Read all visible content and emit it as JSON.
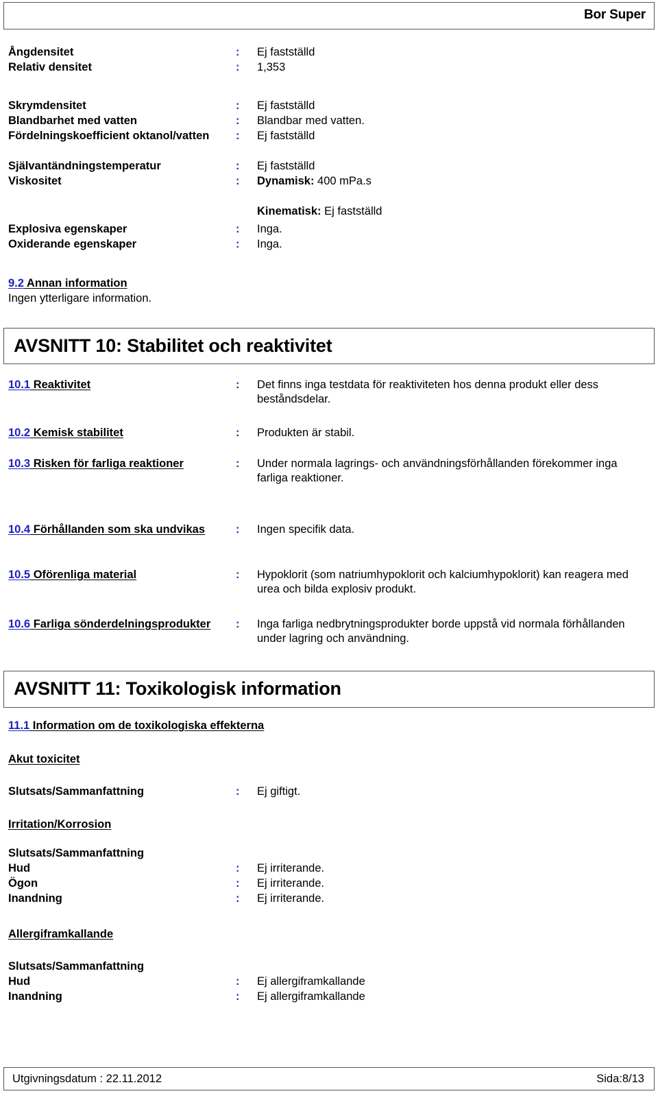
{
  "header": {
    "product_title": "Bor Super"
  },
  "properties_table": {
    "rows": [
      {
        "label": "Ångdensitet",
        "colon": ":",
        "value": "Ej fastställd"
      },
      {
        "label": "Relativ densitet",
        "colon": ":",
        "value": "1,353"
      },
      {
        "label": "Skrymdensitet",
        "colon": ":",
        "value": "Ej fastställd"
      },
      {
        "label": "Blandbarhet med vatten",
        "colon": ":",
        "value": "Blandbar med vatten."
      },
      {
        "label": "Fördelningskoefficient oktanol/vatten",
        "colon": ":",
        "value": "Ej fastställd"
      },
      {
        "label": "Självantändningstemperatur",
        "colon": ":",
        "value": "Ej fastställd"
      },
      {
        "label": "Viskositet",
        "colon": ":",
        "value_bold": "Dynamisk:",
        "value_rest": " 400 mPa.s"
      },
      {
        "label": "",
        "colon": "",
        "value_bold": "Kinematisk:",
        "value_rest": " Ej fastställd"
      },
      {
        "label": "Explosiva egenskaper",
        "colon": ":",
        "value": "Inga."
      },
      {
        "label": "Oxiderande egenskaper",
        "colon": ":",
        "value": "Inga."
      }
    ]
  },
  "section_9_2": {
    "number": "9.2",
    "title": " Annan information",
    "body": "Ingen ytterligare information."
  },
  "section_10": {
    "heading": "AVSNITT 10: Stabilitet och reaktivitet",
    "items": [
      {
        "number": "10.1",
        "title": " Reaktivitet",
        "colon": ":",
        "value": "Det finns inga testdata för reaktiviteten hos denna produkt eller dess beståndsdelar."
      },
      {
        "number": "10.2",
        "title": " Kemisk stabilitet",
        "colon": ":",
        "value": "Produkten är stabil."
      },
      {
        "number": "10.3",
        "title": " Risken för farliga reaktioner",
        "colon": ":",
        "value": "Under normala lagrings- och användningsförhållanden förekommer inga farliga reaktioner."
      },
      {
        "number": "10.4",
        "title": " Förhållanden som ska undvikas",
        "colon": ":",
        "value": "Ingen specifik data."
      },
      {
        "number": "10.5",
        "title": " Oförenliga material",
        "colon": ":",
        "value": "Hypoklorit (som natriumhypoklorit och kalciumhypoklorit) kan reagera med urea och bilda explosiv produkt."
      },
      {
        "number": "10.6",
        "title": " Farliga sönderdelningsprodukter",
        "colon": ":",
        "value": "Inga farliga nedbrytningsprodukter borde uppstå vid normala förhållanden under lagring och användning."
      }
    ]
  },
  "section_11": {
    "heading": "AVSNITT 11: Toxikologisk information",
    "sub_number": "11.1",
    "sub_title": " Information om de toxikologiska effekterna",
    "groups": [
      {
        "heading": "Akut toxicitet",
        "summary_label": "Slutsats/Sammanfattning",
        "inline_colon": ":",
        "inline_value": "Ej giftigt.",
        "rows": []
      },
      {
        "heading": "Irritation/Korrosion",
        "summary_label": "Slutsats/Sammanfattning",
        "rows": [
          {
            "label": "Hud",
            "colon": ":",
            "value": "Ej irriterande."
          },
          {
            "label": "Ögon",
            "colon": ":",
            "value": "Ej irriterande."
          },
          {
            "label": "Inandning",
            "colon": ":",
            "value": "Ej irriterande."
          }
        ]
      },
      {
        "heading": "Allergiframkallande",
        "summary_label": "Slutsats/Sammanfattning",
        "rows": [
          {
            "label": "Hud",
            "colon": ":",
            "value": "Ej allergiframkallande"
          },
          {
            "label": "Inandning",
            "colon": ":",
            "value": "Ej allergiframkallande"
          }
        ]
      }
    ]
  },
  "footer": {
    "issue_label": "Utgivningsdatum : 22.11.2012",
    "page_label": "Sida:8/13"
  },
  "colors": {
    "accent_blue": "#2020c0",
    "colon_blue": "#2a2aa8",
    "border_gray": "#555555",
    "text_black": "#000000"
  }
}
